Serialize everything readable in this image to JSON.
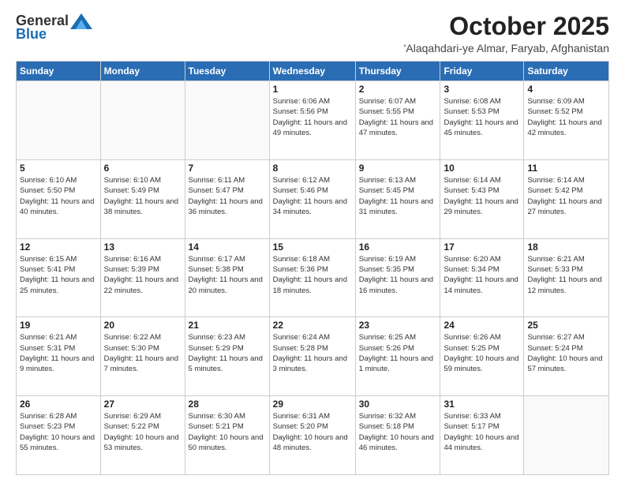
{
  "logo": {
    "general": "General",
    "blue": "Blue"
  },
  "header": {
    "month": "October 2025",
    "location": "'Alaqahdari-ye Almar, Faryab, Afghanistan"
  },
  "weekdays": [
    "Sunday",
    "Monday",
    "Tuesday",
    "Wednesday",
    "Thursday",
    "Friday",
    "Saturday"
  ],
  "weeks": [
    [
      {
        "day": "",
        "info": ""
      },
      {
        "day": "",
        "info": ""
      },
      {
        "day": "",
        "info": ""
      },
      {
        "day": "1",
        "info": "Sunrise: 6:06 AM\nSunset: 5:56 PM\nDaylight: 11 hours and 49 minutes."
      },
      {
        "day": "2",
        "info": "Sunrise: 6:07 AM\nSunset: 5:55 PM\nDaylight: 11 hours and 47 minutes."
      },
      {
        "day": "3",
        "info": "Sunrise: 6:08 AM\nSunset: 5:53 PM\nDaylight: 11 hours and 45 minutes."
      },
      {
        "day": "4",
        "info": "Sunrise: 6:09 AM\nSunset: 5:52 PM\nDaylight: 11 hours and 42 minutes."
      }
    ],
    [
      {
        "day": "5",
        "info": "Sunrise: 6:10 AM\nSunset: 5:50 PM\nDaylight: 11 hours and 40 minutes."
      },
      {
        "day": "6",
        "info": "Sunrise: 6:10 AM\nSunset: 5:49 PM\nDaylight: 11 hours and 38 minutes."
      },
      {
        "day": "7",
        "info": "Sunrise: 6:11 AM\nSunset: 5:47 PM\nDaylight: 11 hours and 36 minutes."
      },
      {
        "day": "8",
        "info": "Sunrise: 6:12 AM\nSunset: 5:46 PM\nDaylight: 11 hours and 34 minutes."
      },
      {
        "day": "9",
        "info": "Sunrise: 6:13 AM\nSunset: 5:45 PM\nDaylight: 11 hours and 31 minutes."
      },
      {
        "day": "10",
        "info": "Sunrise: 6:14 AM\nSunset: 5:43 PM\nDaylight: 11 hours and 29 minutes."
      },
      {
        "day": "11",
        "info": "Sunrise: 6:14 AM\nSunset: 5:42 PM\nDaylight: 11 hours and 27 minutes."
      }
    ],
    [
      {
        "day": "12",
        "info": "Sunrise: 6:15 AM\nSunset: 5:41 PM\nDaylight: 11 hours and 25 minutes."
      },
      {
        "day": "13",
        "info": "Sunrise: 6:16 AM\nSunset: 5:39 PM\nDaylight: 11 hours and 22 minutes."
      },
      {
        "day": "14",
        "info": "Sunrise: 6:17 AM\nSunset: 5:38 PM\nDaylight: 11 hours and 20 minutes."
      },
      {
        "day": "15",
        "info": "Sunrise: 6:18 AM\nSunset: 5:36 PM\nDaylight: 11 hours and 18 minutes."
      },
      {
        "day": "16",
        "info": "Sunrise: 6:19 AM\nSunset: 5:35 PM\nDaylight: 11 hours and 16 minutes."
      },
      {
        "day": "17",
        "info": "Sunrise: 6:20 AM\nSunset: 5:34 PM\nDaylight: 11 hours and 14 minutes."
      },
      {
        "day": "18",
        "info": "Sunrise: 6:21 AM\nSunset: 5:33 PM\nDaylight: 11 hours and 12 minutes."
      }
    ],
    [
      {
        "day": "19",
        "info": "Sunrise: 6:21 AM\nSunset: 5:31 PM\nDaylight: 11 hours and 9 minutes."
      },
      {
        "day": "20",
        "info": "Sunrise: 6:22 AM\nSunset: 5:30 PM\nDaylight: 11 hours and 7 minutes."
      },
      {
        "day": "21",
        "info": "Sunrise: 6:23 AM\nSunset: 5:29 PM\nDaylight: 11 hours and 5 minutes."
      },
      {
        "day": "22",
        "info": "Sunrise: 6:24 AM\nSunset: 5:28 PM\nDaylight: 11 hours and 3 minutes."
      },
      {
        "day": "23",
        "info": "Sunrise: 6:25 AM\nSunset: 5:26 PM\nDaylight: 11 hours and 1 minute."
      },
      {
        "day": "24",
        "info": "Sunrise: 6:26 AM\nSunset: 5:25 PM\nDaylight: 10 hours and 59 minutes."
      },
      {
        "day": "25",
        "info": "Sunrise: 6:27 AM\nSunset: 5:24 PM\nDaylight: 10 hours and 57 minutes."
      }
    ],
    [
      {
        "day": "26",
        "info": "Sunrise: 6:28 AM\nSunset: 5:23 PM\nDaylight: 10 hours and 55 minutes."
      },
      {
        "day": "27",
        "info": "Sunrise: 6:29 AM\nSunset: 5:22 PM\nDaylight: 10 hours and 53 minutes."
      },
      {
        "day": "28",
        "info": "Sunrise: 6:30 AM\nSunset: 5:21 PM\nDaylight: 10 hours and 50 minutes."
      },
      {
        "day": "29",
        "info": "Sunrise: 6:31 AM\nSunset: 5:20 PM\nDaylight: 10 hours and 48 minutes."
      },
      {
        "day": "30",
        "info": "Sunrise: 6:32 AM\nSunset: 5:18 PM\nDaylight: 10 hours and 46 minutes."
      },
      {
        "day": "31",
        "info": "Sunrise: 6:33 AM\nSunset: 5:17 PM\nDaylight: 10 hours and 44 minutes."
      },
      {
        "day": "",
        "info": ""
      }
    ]
  ]
}
